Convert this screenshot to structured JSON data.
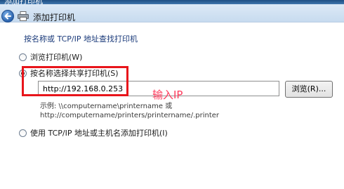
{
  "window": {
    "title": "添加打印机"
  },
  "header": {
    "back_icon": "back-arrow-icon",
    "printer_icon": "printer-icon",
    "title": "添加打印机"
  },
  "section": {
    "heading": "按名称或 TCP/IP 地址查找打印机"
  },
  "options": [
    {
      "label": "浏览打印机(W)",
      "checked": false
    },
    {
      "label": "按名称选择共享打印机(S)",
      "checked": true
    },
    {
      "label": "使用 TCP/IP 地址或主机名添加打印机(I)",
      "checked": false
    }
  ],
  "share_input": {
    "value": "http://192.168.0.253"
  },
  "browse_button": {
    "label": "浏览(R)..."
  },
  "example": {
    "line1": "示例: \\\\computername\\printername 或",
    "line2": "http://computername/printers/printername/.printer"
  },
  "annotation": {
    "text": "输入IP",
    "color": "#ff3b5c",
    "box_color": "#e8151b"
  }
}
